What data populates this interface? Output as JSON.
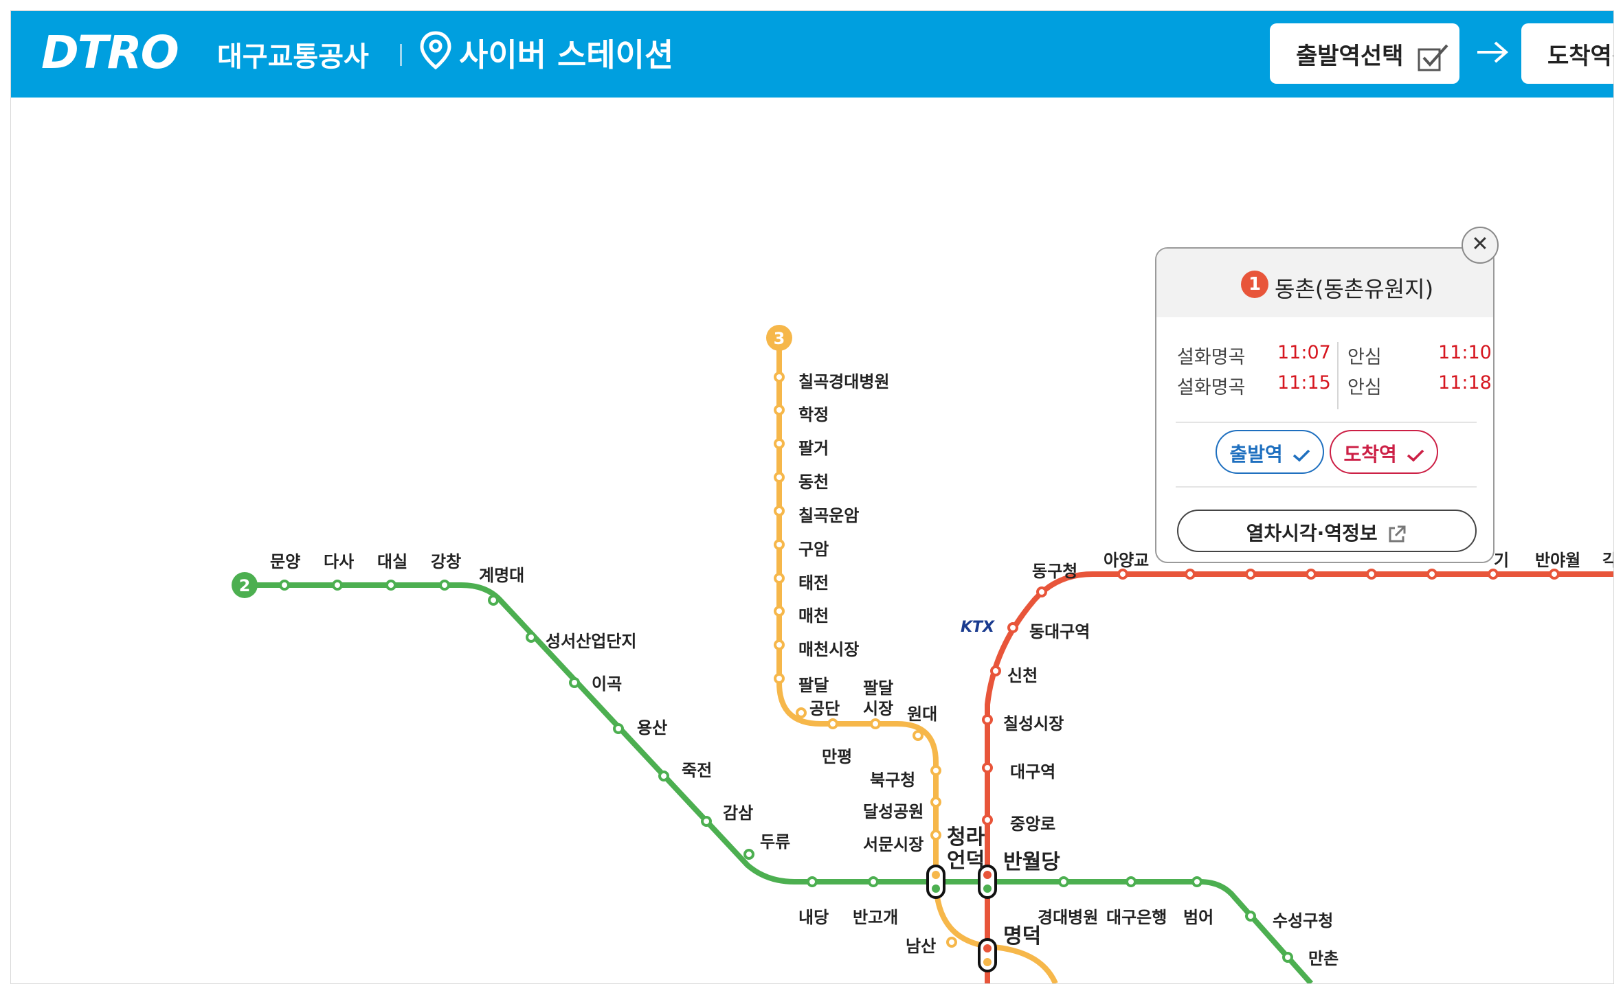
{
  "header": {
    "logo": "DTRO",
    "org_name": "대구교통공사",
    "site_title": "사이버 스테이션",
    "depart_button": "출발역선택",
    "arrive_button": "도착역선"
  },
  "colors": {
    "header_bg": "#009fdf",
    "line1": "#e8553a",
    "line2": "#4caf50",
    "line3": "#f6b74a",
    "time_red": "#d6161f"
  },
  "lines": {
    "line2_badge": "2",
    "line3_badge": "3",
    "ktx_logo": "KTX"
  },
  "stations": {
    "line2": [
      "문양",
      "다사",
      "대실",
      "강창",
      "계명대",
      "성서산업단지",
      "이곡",
      "용산",
      "죽전",
      "감삼",
      "두류",
      "내당",
      "반고개",
      "경대병원",
      "대구은행",
      "범어",
      "수성구청",
      "만촌"
    ],
    "line3": [
      "칠곡경대병원",
      "학정",
      "팔거",
      "동천",
      "칠곡운암",
      "구암",
      "태전",
      "매천",
      "매천시장",
      "팔달",
      "공단",
      "팔달",
      "시장",
      "원대",
      "만평",
      "북구청",
      "달성공원",
      "서문시장",
      "남산"
    ],
    "line1": [
      "동구청",
      "아양교",
      "기",
      "반야월",
      "각",
      "동대구역",
      "신천",
      "칠성시장",
      "대구역",
      "중앙로",
      "명덕"
    ],
    "transfer": [
      "청라",
      "언덕",
      "반월당"
    ]
  },
  "popup": {
    "line_number": "1",
    "station_name": "동촌(동촌유원지)",
    "close_label": "✕",
    "timetable": [
      {
        "dest": "설화명곡",
        "time": "11:07",
        "dest2": "안심",
        "time2": "11:10"
      },
      {
        "dest": "설화명곡",
        "time": "11:15",
        "dest2": "안심",
        "time2": "11:18"
      }
    ],
    "depart_label": "출발역",
    "arrive_label": "도착역",
    "info_label": "열차시각·역정보"
  }
}
